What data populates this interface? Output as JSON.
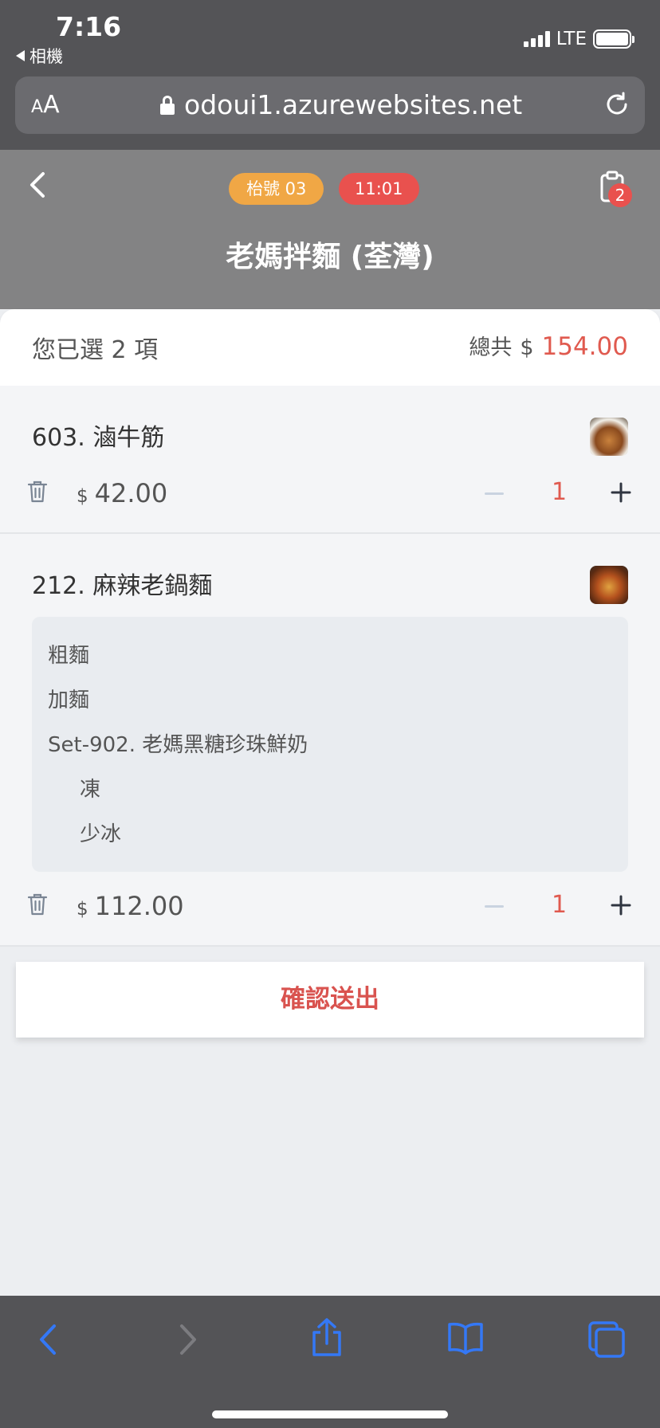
{
  "status_bar": {
    "time": "7:16",
    "back_app": "相機",
    "network": "LTE"
  },
  "browser": {
    "aa_small": "A",
    "aa_big": "A",
    "url": "odoui1.azurewebsites.net"
  },
  "header": {
    "table_badge": "枱號 03",
    "time_badge": "11:01",
    "cart_count": "2",
    "store_name": "老媽拌麵 (荃灣)"
  },
  "summary": {
    "selected_text": "您已選 2 項",
    "total_label": "總共",
    "currency": "$",
    "total_value": "154.00"
  },
  "items": [
    {
      "name": "603. 滷牛筋",
      "currency": "$",
      "price": "42.00",
      "qty": "1"
    },
    {
      "name": "212. 麻辣老鍋麵",
      "currency": "$",
      "price": "112.00",
      "qty": "1",
      "options": [
        "粗麵",
        "加麵",
        "Set-902. 老媽黑糖珍珠鮮奶",
        "凍",
        "少冰"
      ]
    }
  ],
  "confirm_label": "確認送出",
  "colors": {
    "accent_red": "#e9514e",
    "badge_orange": "#f0a745",
    "chrome_gray": "#545457",
    "safari_blue": "#3478f6"
  }
}
